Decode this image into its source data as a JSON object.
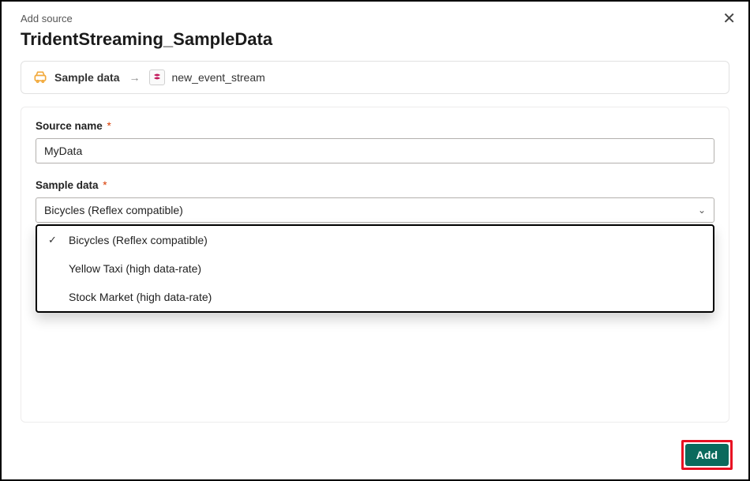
{
  "header": {
    "small_title": "Add source",
    "page_title": "TridentStreaming_SampleData"
  },
  "breadcrumb": {
    "source_label": "Sample data",
    "target_label": "new_event_stream"
  },
  "form": {
    "source_name_label": "Source name",
    "source_name_value": "MyData",
    "sample_data_label": "Sample data",
    "sample_data_selected": "Bicycles (Reflex compatible)"
  },
  "dropdown": {
    "options": [
      {
        "label": "Bicycles (Reflex compatible)",
        "checked": true
      },
      {
        "label": "Yellow Taxi (high data-rate)",
        "checked": false
      },
      {
        "label": "Stock Market (high data-rate)",
        "checked": false
      }
    ]
  },
  "footer": {
    "add_label": "Add"
  }
}
